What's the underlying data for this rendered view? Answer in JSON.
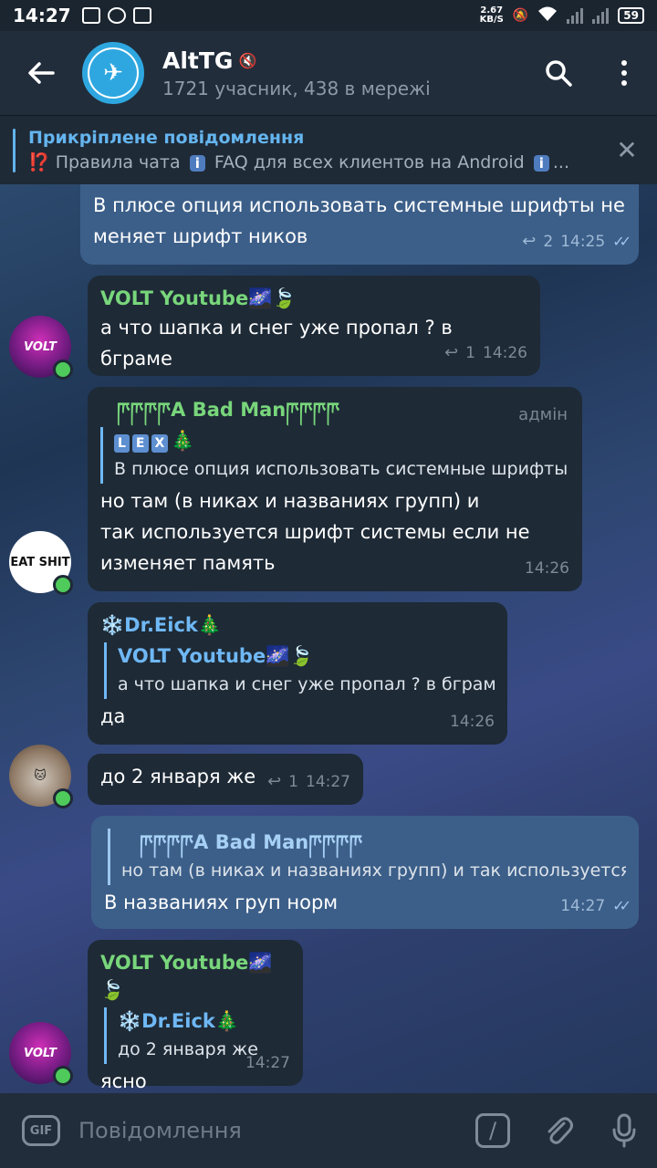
{
  "status_bar": {
    "time": "14:27",
    "net_speed_value": "2.67",
    "net_speed_unit": "KB/S",
    "battery": "59"
  },
  "header": {
    "title": "AltTG",
    "subtitle": "1721 учасник, 438 в мережі"
  },
  "pinned": {
    "title": "Прикріплене повідомлення",
    "text_a": "⁉️ Правила чата",
    "badge_a": "i",
    "text_b": "FAQ для всех клиентов на Android",
    "badge_b": "i",
    "ellipsis": "..."
  },
  "messages": [
    {
      "text_1": "В плюсе опция использовать системные шрифты не",
      "text_2": "меняет шрифт ников",
      "replies": "2",
      "time": "14:25"
    },
    {
      "sender": "VOLT Youtube🌌🍃",
      "text": "а что шапка и снег уже пропал ? в бграме",
      "replies": "1",
      "time": "14:26",
      "avatar_text": "VOLT"
    },
    {
      "sender": "ཫཫཫཫA Bad Manཫཫཫཫ",
      "role": "адмін",
      "reply_tags": [
        "L",
        "E",
        "X"
      ],
      "reply_tree": "🎄",
      "reply_text": "В плюсе опция использовать системные шрифты...",
      "text_1": "но там (в никах и названиях групп) и",
      "text_2": "так используется шрифт системы если не",
      "text_3": "изменяет память",
      "time": "14:26",
      "avatar_text": "EAT SHIT"
    },
    {
      "sender": "❄️Dr.Eick🎄",
      "reply_name": "VOLT Youtube🌌🍃",
      "reply_text": "а что шапка и снег уже пропал ? в бграме",
      "text": "да",
      "time": "14:26"
    },
    {
      "text": "до 2 января же",
      "replies": "1",
      "time": "14:27"
    },
    {
      "reply_name": "ཫཫཫཫA Bad Manཫཫཫཫ",
      "reply_text": "но там (в никах и названиях групп) и так используется...",
      "text": "В названиях груп норм",
      "time": "14:27"
    },
    {
      "sender": "VOLT Youtube🌌🍃",
      "reply_name": "❄️Dr.Eick🎄",
      "reply_text": "до 2 января же",
      "text": "ясно",
      "time": "14:27",
      "avatar_text": "VOLT"
    }
  ],
  "input": {
    "gif_label": "GIF",
    "placeholder": "Повідомлення"
  },
  "colors": {
    "header_bg": "#212d3b",
    "incoming_bubble": "#1e2a36",
    "outgoing_bubble": "#3c5f89",
    "sender_green": "#78d67b",
    "link_blue": "#6fb8f5",
    "online_dot": "#4ecb5b"
  },
  "icons": [
    "back-arrow-icon",
    "search-icon",
    "more-vert-icon",
    "mute-icon",
    "close-icon",
    "reply-count-icon",
    "double-check-icon",
    "gif-icon",
    "bot-command-icon",
    "attach-icon",
    "mic-icon"
  ]
}
